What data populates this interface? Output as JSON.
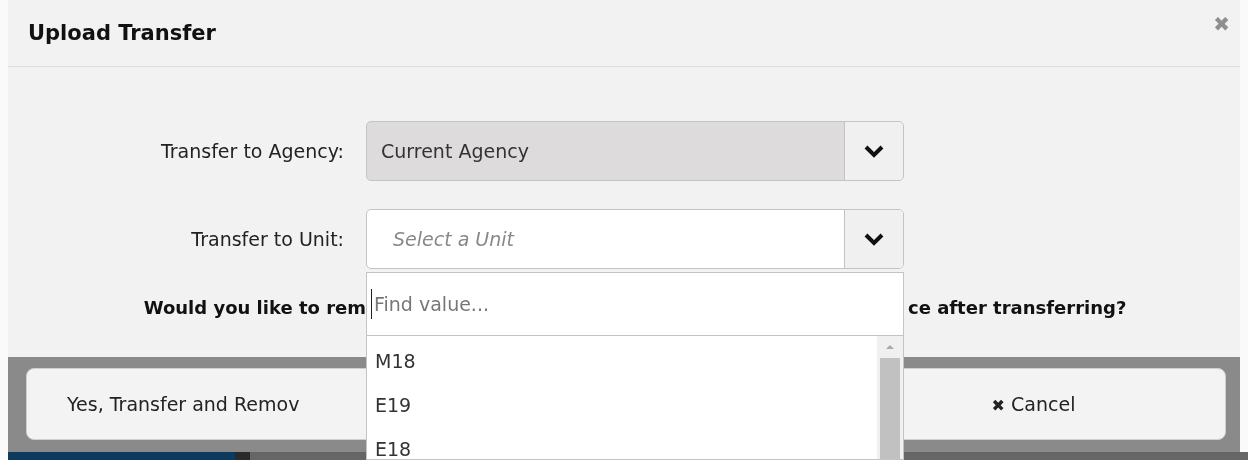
{
  "dialog": {
    "title": "Upload Transfer",
    "close_icon": "✖"
  },
  "fields": [
    {
      "label": "Transfer to Agency:",
      "kind": "filled",
      "value": "Current Agency",
      "disabled": true
    },
    {
      "label": "Transfer to Unit:",
      "kind": "empty",
      "placeholder": "Select a Unit",
      "disabled": false
    }
  ],
  "question": {
    "before": "Would you like to rem",
    "after": "ce after transferring?"
  },
  "buttons": [
    {
      "label": "Yes, Transfer and Remov",
      "kind": "plain"
    },
    {
      "label": "Cancel",
      "kind": "cancel",
      "icon": "✖"
    }
  ],
  "dropdown": {
    "search_placeholder": "Find value...",
    "options": [
      "M18",
      "E19",
      "E18"
    ]
  }
}
